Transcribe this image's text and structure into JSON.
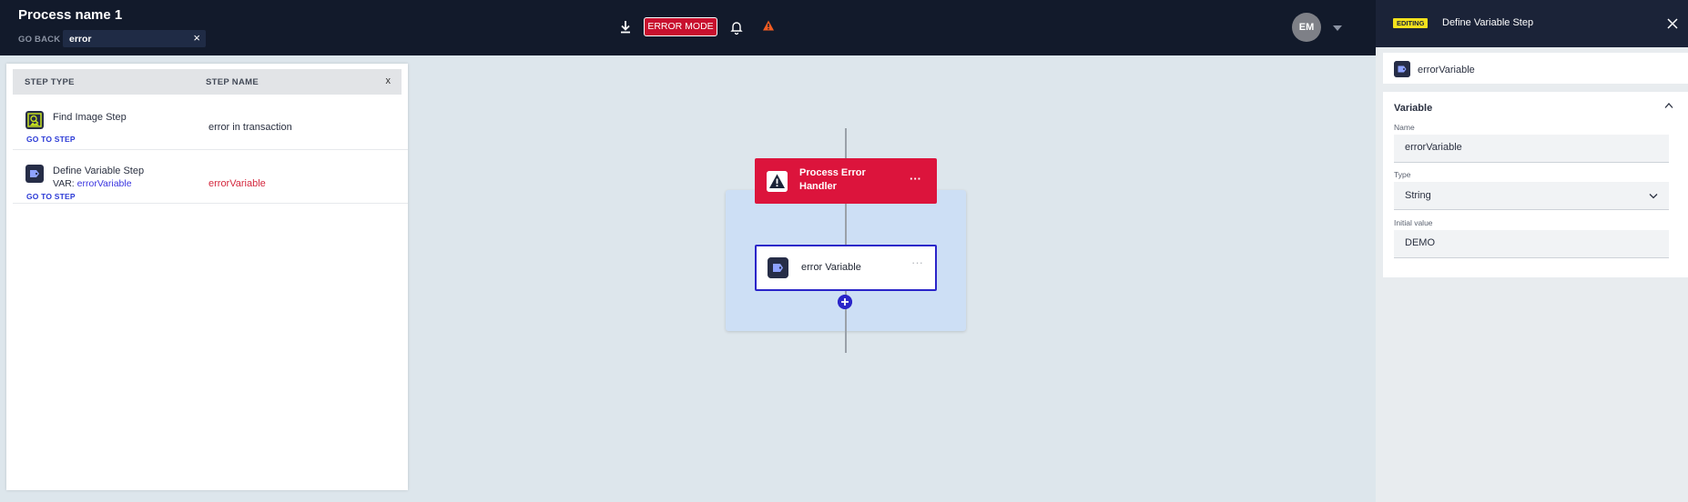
{
  "header": {
    "process_title": "Process name 1",
    "go_back": "GO BACK",
    "search_value": "error",
    "clear_symbol": "×",
    "error_mode_label": "ERROR MODE",
    "avatar_initials": "EM"
  },
  "results": {
    "col_step_type": "STEP TYPE",
    "col_step_name": "STEP NAME",
    "close_symbol": "x",
    "rows": [
      {
        "step_type": "Find Image Step",
        "var_prefix": "",
        "var_name": "",
        "goto": "GO TO STEP",
        "step_name": "error in transaction"
      },
      {
        "step_type": "Define Variable Step",
        "var_prefix": "VAR: ",
        "var_name": "errorVariable",
        "goto": "GO TO STEP",
        "step_name": "errorVariable"
      }
    ]
  },
  "canvas": {
    "handler_label": "Process Error Handler",
    "more_symbol": "···",
    "node_label": "error Variable"
  },
  "editor": {
    "badge": "EDITING",
    "title": "Define Variable Step",
    "step_name": "errorVariable",
    "section": "Variable",
    "name_label": "Name",
    "name_value": "errorVariable",
    "type_label": "Type",
    "type_value": "String",
    "initial_label": "Initial value",
    "initial_value": "DEMO"
  },
  "colors": {
    "topbar": "#121a2b",
    "error_red": "#dc143c",
    "accent_blue": "#2a25c9",
    "container": "#cddff5",
    "badge_yellow": "#f3e11c"
  },
  "icons": [
    "download-icon",
    "bell-icon",
    "warning-icon",
    "find-image-icon",
    "define-variable-icon",
    "close-icon",
    "chevron-down-icon",
    "chevron-up-icon",
    "plus-icon"
  ]
}
